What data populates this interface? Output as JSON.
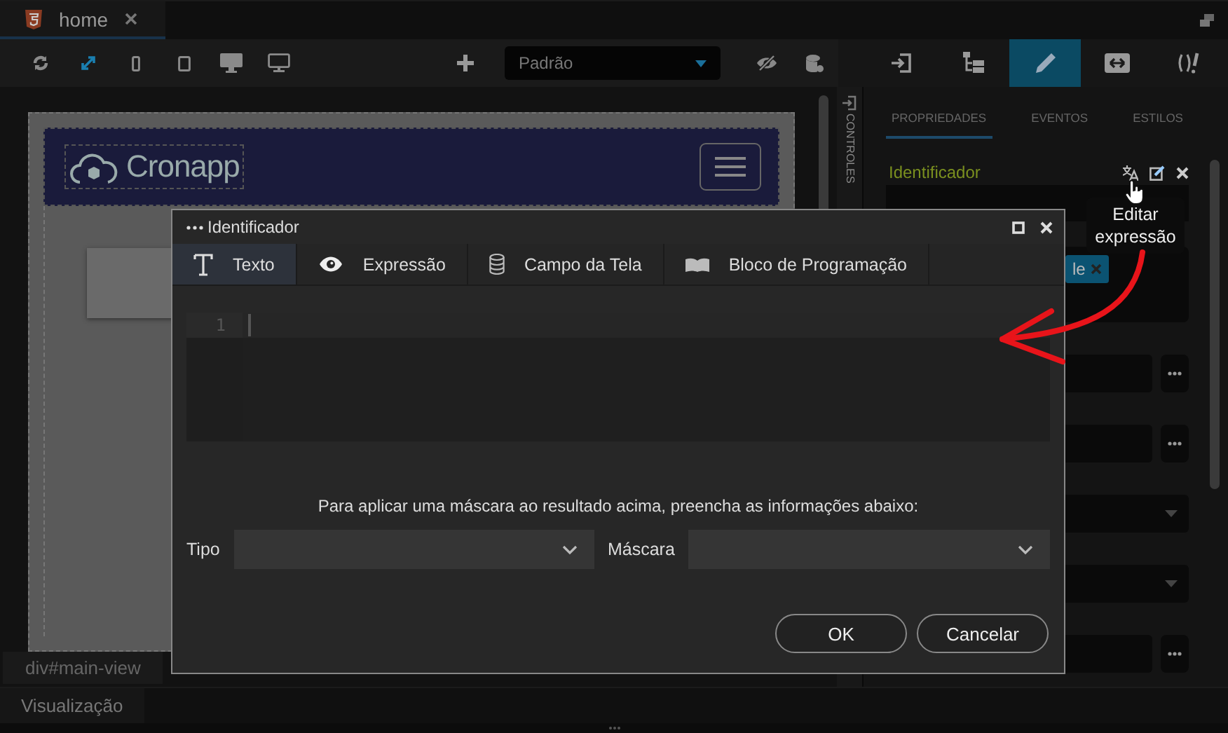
{
  "file_tab": {
    "title": "home"
  },
  "toolbar": {
    "tools": [
      {
        "kind": "refresh",
        "selected": false
      },
      {
        "kind": "expand",
        "selected": true
      },
      {
        "kind": "phone",
        "selected": false
      },
      {
        "kind": "tablet",
        "selected": false
      },
      {
        "kind": "desktop",
        "selected": false
      },
      {
        "kind": "monitor",
        "selected": false
      }
    ],
    "layout_select": "Padrão"
  },
  "panel_tools": [
    {
      "kind": "login",
      "selected": false
    },
    {
      "kind": "tree",
      "selected": false
    },
    {
      "kind": "pencil",
      "selected": true
    },
    {
      "kind": "resize",
      "selected": false
    },
    {
      "kind": "code",
      "selected": false
    }
  ],
  "canvas": {
    "logo": "Cronapp"
  },
  "side_strip": "CONTROLES",
  "breadcrumb": "div#main-view",
  "bottom_tabs": [
    {
      "label": "Visualização"
    }
  ],
  "properties": {
    "tabs": [
      {
        "label": "PROPRIEDADES",
        "selected": true
      },
      {
        "label": "EVENTOS",
        "selected": false
      },
      {
        "label": "ESTILOS",
        "selected": false
      }
    ],
    "label": "Identificador",
    "tooltip": "Editar expressão",
    "chip": "le",
    "rows": [
      {
        "kind": "field"
      },
      {
        "kind": "field"
      },
      {
        "kind": "select"
      },
      {
        "kind": "select"
      },
      {
        "kind": "field"
      }
    ]
  },
  "dialog": {
    "title": "Identificador",
    "tabs": [
      {
        "label": "Texto",
        "kind": "text",
        "selected": true
      },
      {
        "label": "Expressão",
        "kind": "eye",
        "selected": false
      },
      {
        "label": "Campo da Tela",
        "kind": "database",
        "selected": false
      },
      {
        "label": "Bloco de Programação",
        "kind": "block",
        "selected": false
      }
    ],
    "line_numbers": [
      "1"
    ],
    "mask_hint": "Para aplicar uma máscara ao resultado acima, preencha as informações abaixo:",
    "fields": [
      {
        "label": "Tipo"
      },
      {
        "label": "Máscara"
      }
    ],
    "buttons": [
      "OK",
      "Cancelar"
    ]
  }
}
